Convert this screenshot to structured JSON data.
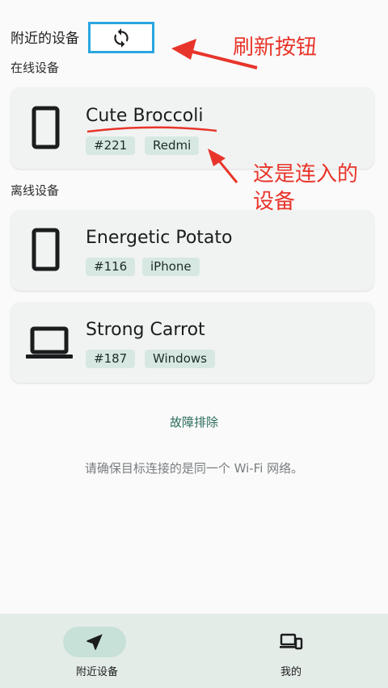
{
  "header": {
    "title": "附近的设备",
    "refresh_icon": "refresh-icon"
  },
  "sections": {
    "online": "在线设备",
    "offline": "离线设备"
  },
  "online_devices": [
    {
      "name": "Cute Broccoli",
      "id": "#221",
      "brand": "Redmi",
      "icon": "tablet-icon"
    }
  ],
  "offline_devices": [
    {
      "name": "Energetic Potato",
      "id": "#116",
      "brand": "iPhone",
      "icon": "tablet-icon"
    },
    {
      "name": "Strong Carrot",
      "id": "#187",
      "brand": "Windows",
      "icon": "laptop-icon"
    }
  ],
  "troubleshoot": "故障排除",
  "hint": "请确保目标连接的是同一个 Wi-Fi 网络。",
  "bottom_nav": [
    {
      "label": "附近设备",
      "icon": "navigation-arrow-icon",
      "active": true
    },
    {
      "label": "我的",
      "icon": "devices-icon",
      "active": false
    }
  ],
  "annotations": {
    "refresh": "刷新按钮",
    "connected_line1": "这是连入的",
    "connected_line2": "设备"
  },
  "colors": {
    "accent": "#2a6b5c",
    "chip_bg": "#d7e8e2",
    "annotation_red": "#e8352b",
    "highlight_blue": "#2aa6e0"
  }
}
